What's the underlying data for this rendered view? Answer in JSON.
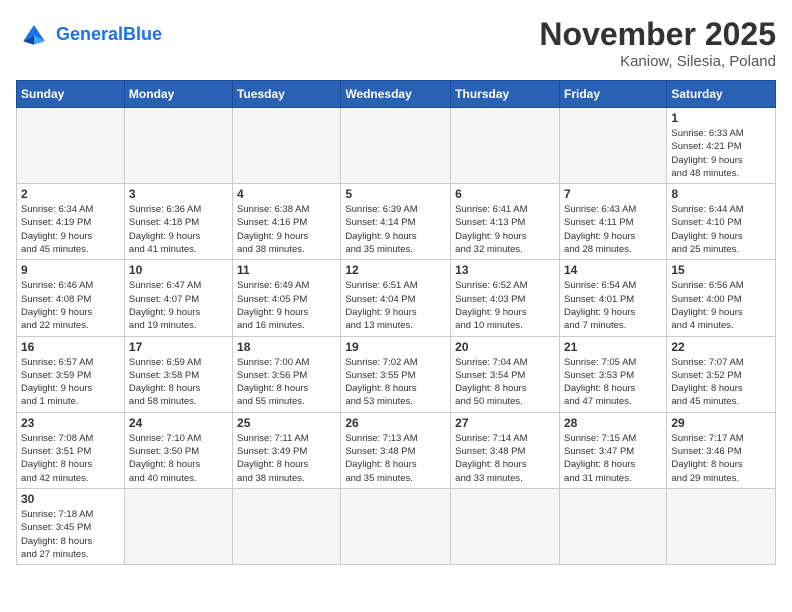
{
  "header": {
    "logo_general": "General",
    "logo_blue": "Blue",
    "month_title": "November 2025",
    "location": "Kaniow, Silesia, Poland"
  },
  "weekdays": [
    "Sunday",
    "Monday",
    "Tuesday",
    "Wednesday",
    "Thursday",
    "Friday",
    "Saturday"
  ],
  "weeks": [
    [
      {
        "day": "",
        "info": ""
      },
      {
        "day": "",
        "info": ""
      },
      {
        "day": "",
        "info": ""
      },
      {
        "day": "",
        "info": ""
      },
      {
        "day": "",
        "info": ""
      },
      {
        "day": "",
        "info": ""
      },
      {
        "day": "1",
        "info": "Sunrise: 6:33 AM\nSunset: 4:21 PM\nDaylight: 9 hours\nand 48 minutes."
      }
    ],
    [
      {
        "day": "2",
        "info": "Sunrise: 6:34 AM\nSunset: 4:19 PM\nDaylight: 9 hours\nand 45 minutes."
      },
      {
        "day": "3",
        "info": "Sunrise: 6:36 AM\nSunset: 4:18 PM\nDaylight: 9 hours\nand 41 minutes."
      },
      {
        "day": "4",
        "info": "Sunrise: 6:38 AM\nSunset: 4:16 PM\nDaylight: 9 hours\nand 38 minutes."
      },
      {
        "day": "5",
        "info": "Sunrise: 6:39 AM\nSunset: 4:14 PM\nDaylight: 9 hours\nand 35 minutes."
      },
      {
        "day": "6",
        "info": "Sunrise: 6:41 AM\nSunset: 4:13 PM\nDaylight: 9 hours\nand 32 minutes."
      },
      {
        "day": "7",
        "info": "Sunrise: 6:43 AM\nSunset: 4:11 PM\nDaylight: 9 hours\nand 28 minutes."
      },
      {
        "day": "8",
        "info": "Sunrise: 6:44 AM\nSunset: 4:10 PM\nDaylight: 9 hours\nand 25 minutes."
      }
    ],
    [
      {
        "day": "9",
        "info": "Sunrise: 6:46 AM\nSunset: 4:08 PM\nDaylight: 9 hours\nand 22 minutes."
      },
      {
        "day": "10",
        "info": "Sunrise: 6:47 AM\nSunset: 4:07 PM\nDaylight: 9 hours\nand 19 minutes."
      },
      {
        "day": "11",
        "info": "Sunrise: 6:49 AM\nSunset: 4:05 PM\nDaylight: 9 hours\nand 16 minutes."
      },
      {
        "day": "12",
        "info": "Sunrise: 6:51 AM\nSunset: 4:04 PM\nDaylight: 9 hours\nand 13 minutes."
      },
      {
        "day": "13",
        "info": "Sunrise: 6:52 AM\nSunset: 4:03 PM\nDaylight: 9 hours\nand 10 minutes."
      },
      {
        "day": "14",
        "info": "Sunrise: 6:54 AM\nSunset: 4:01 PM\nDaylight: 9 hours\nand 7 minutes."
      },
      {
        "day": "15",
        "info": "Sunrise: 6:56 AM\nSunset: 4:00 PM\nDaylight: 9 hours\nand 4 minutes."
      }
    ],
    [
      {
        "day": "16",
        "info": "Sunrise: 6:57 AM\nSunset: 3:59 PM\nDaylight: 9 hours\nand 1 minute."
      },
      {
        "day": "17",
        "info": "Sunrise: 6:59 AM\nSunset: 3:58 PM\nDaylight: 8 hours\nand 58 minutes."
      },
      {
        "day": "18",
        "info": "Sunrise: 7:00 AM\nSunset: 3:56 PM\nDaylight: 8 hours\nand 55 minutes."
      },
      {
        "day": "19",
        "info": "Sunrise: 7:02 AM\nSunset: 3:55 PM\nDaylight: 8 hours\nand 53 minutes."
      },
      {
        "day": "20",
        "info": "Sunrise: 7:04 AM\nSunset: 3:54 PM\nDaylight: 8 hours\nand 50 minutes."
      },
      {
        "day": "21",
        "info": "Sunrise: 7:05 AM\nSunset: 3:53 PM\nDaylight: 8 hours\nand 47 minutes."
      },
      {
        "day": "22",
        "info": "Sunrise: 7:07 AM\nSunset: 3:52 PM\nDaylight: 8 hours\nand 45 minutes."
      }
    ],
    [
      {
        "day": "23",
        "info": "Sunrise: 7:08 AM\nSunset: 3:51 PM\nDaylight: 8 hours\nand 42 minutes."
      },
      {
        "day": "24",
        "info": "Sunrise: 7:10 AM\nSunset: 3:50 PM\nDaylight: 8 hours\nand 40 minutes."
      },
      {
        "day": "25",
        "info": "Sunrise: 7:11 AM\nSunset: 3:49 PM\nDaylight: 8 hours\nand 38 minutes."
      },
      {
        "day": "26",
        "info": "Sunrise: 7:13 AM\nSunset: 3:48 PM\nDaylight: 8 hours\nand 35 minutes."
      },
      {
        "day": "27",
        "info": "Sunrise: 7:14 AM\nSunset: 3:48 PM\nDaylight: 8 hours\nand 33 minutes."
      },
      {
        "day": "28",
        "info": "Sunrise: 7:15 AM\nSunset: 3:47 PM\nDaylight: 8 hours\nand 31 minutes."
      },
      {
        "day": "29",
        "info": "Sunrise: 7:17 AM\nSunset: 3:46 PM\nDaylight: 8 hours\nand 29 minutes."
      }
    ],
    [
      {
        "day": "30",
        "info": "Sunrise: 7:18 AM\nSunset: 3:45 PM\nDaylight: 8 hours\nand 27 minutes."
      },
      {
        "day": "",
        "info": ""
      },
      {
        "day": "",
        "info": ""
      },
      {
        "day": "",
        "info": ""
      },
      {
        "day": "",
        "info": ""
      },
      {
        "day": "",
        "info": ""
      },
      {
        "day": "",
        "info": ""
      }
    ]
  ]
}
